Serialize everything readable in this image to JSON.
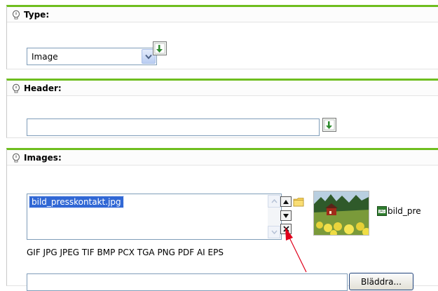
{
  "type_panel": {
    "title": "Type:",
    "selected": "Image"
  },
  "header_panel": {
    "title": "Header:",
    "value": ""
  },
  "images_panel": {
    "title": "Images:",
    "list_items": [
      "bild_presskontakt.jpg"
    ],
    "preview_caption": "bild_pre",
    "file_types": "GIF JPG JPEG TIF BMP PCX TGA PNG PDF AI EPS",
    "upload_value": "",
    "browse_label": "Bläddra..."
  },
  "annotation": {
    "arrow_color": "#e0001b"
  },
  "colors": {
    "panel_border": "#6fbe1f",
    "selection": "#3168d5"
  },
  "icons": {
    "help": "help-bulb-icon",
    "pick": "pick-green-arrow-icon",
    "folder": "folder-icon",
    "remove": "remove-x-icon",
    "file": "jpg-file-icon"
  }
}
